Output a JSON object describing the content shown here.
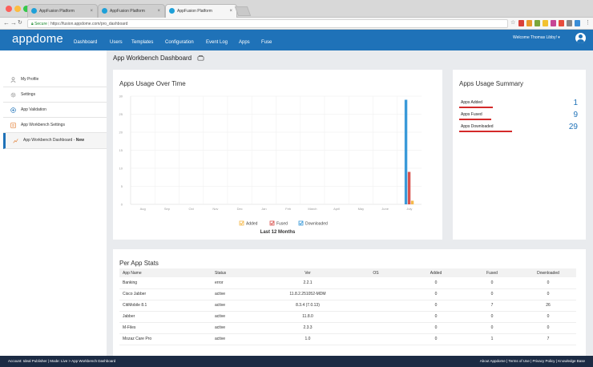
{
  "browser": {
    "tabs": [
      {
        "title": "AppFusion Platform"
      },
      {
        "title": "AppFusion Platform"
      },
      {
        "title": "AppFusion Platform"
      }
    ],
    "close_glyph": "×",
    "url_secure": "Secure",
    "url": "https://fusion.appdome.com/pro_dashboard"
  },
  "header": {
    "logo": "appdome",
    "nav": [
      "Dashboard",
      "Users",
      "Templates",
      "Configuration",
      "Event Log",
      "Apps",
      "Fuse"
    ],
    "welcome": "Welcome Thomas Libby! ▾"
  },
  "sidebar": {
    "items": [
      {
        "label": "My Profile",
        "icon": "user-icon"
      },
      {
        "label": "Settings",
        "icon": "gear-icon"
      },
      {
        "label": "App Validation",
        "icon": "plus-circle-icon"
      },
      {
        "label": "App Workbench Settings",
        "icon": "workbench-icon"
      },
      {
        "label": "App Workbench Dashboard - ",
        "badge": "New",
        "icon": "chart-icon"
      }
    ]
  },
  "page": {
    "title": "App Workbench Dashboard"
  },
  "usage_chart": {
    "title": "Apps Usage Over Time",
    "footer": "Last 12 Months"
  },
  "chart_data": {
    "type": "bar",
    "categories": [
      "Aug",
      "Sep",
      "Oct",
      "Nov",
      "Dec",
      "Jan",
      "Feb",
      "March",
      "April",
      "May",
      "June",
      "July"
    ],
    "series": [
      {
        "name": "Added",
        "color": "#f5b94a",
        "values": [
          0,
          0,
          0,
          0,
          0,
          0,
          0,
          0,
          0,
          0,
          0,
          1
        ]
      },
      {
        "name": "Fused",
        "color": "#d9534f",
        "values": [
          0,
          0,
          0,
          0,
          0,
          0,
          0,
          0,
          0,
          0,
          0,
          9
        ]
      },
      {
        "name": "Downloaded",
        "color": "#3a9ad9",
        "values": [
          0,
          0,
          0,
          0,
          0,
          0,
          0,
          0,
          0,
          0,
          0,
          29
        ]
      }
    ],
    "yticks": [
      0,
      5,
      10,
      15,
      20,
      25,
      30
    ],
    "ylim": [
      0,
      30
    ],
    "legend": "bottom"
  },
  "summary": {
    "title": "Apps Usage Summary",
    "rows": [
      {
        "label": "Apps Added",
        "value": "1"
      },
      {
        "label": "Apps Fused",
        "value": "9"
      },
      {
        "label": "Apps Downloaded",
        "value": "29"
      }
    ]
  },
  "per_app": {
    "title": "Per App Stats",
    "columns": [
      "App Name",
      "Status",
      "Ver",
      "OS",
      "Added",
      "Fused",
      "Downloaded"
    ],
    "rows": [
      [
        "Banking",
        "error",
        "2.2.1",
        "",
        "0",
        "0",
        "0"
      ],
      [
        "Cisco Jabber",
        "active",
        "11.8.2.251052-MDM",
        "",
        "0",
        "0",
        "0"
      ],
      [
        "CitiMobile 8.1",
        "active",
        "8.3.4 (7.0.13)",
        "",
        "0",
        "7",
        "26"
      ],
      [
        "Jabber",
        "active",
        "11.8.0",
        "",
        "0",
        "0",
        "0"
      ],
      [
        "M-Files",
        "active",
        "2.3.3",
        "",
        "0",
        "0",
        "0"
      ],
      [
        "Mozaz Care Pro",
        "active",
        "1.0",
        "",
        "0",
        "1",
        "7"
      ]
    ]
  },
  "footer": {
    "left": "Account: Ideal Publisher  |  Mode: Live  >  App Workbench Dashboard",
    "right": "About Appdome  |  Terms of Use  |  Privacy Policy  |  Knowledge Base"
  }
}
